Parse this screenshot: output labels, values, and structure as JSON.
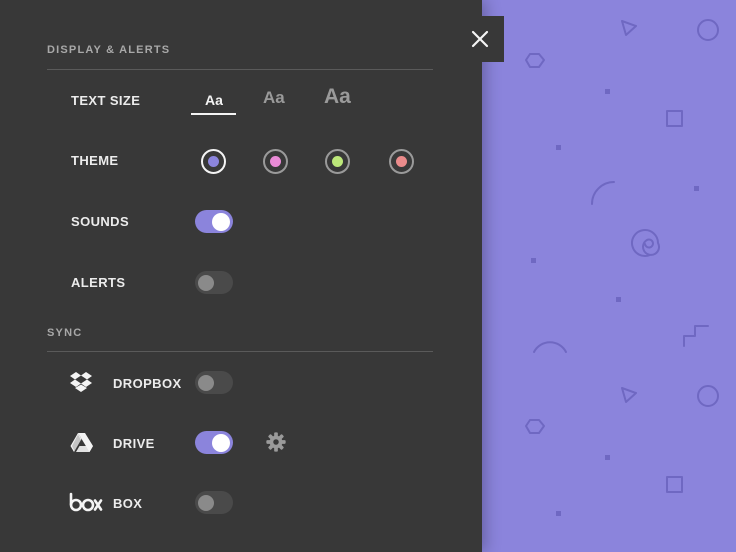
{
  "sections": {
    "display_title": "DISPLAY & ALERTS",
    "sync_title": "SYNC"
  },
  "settings": {
    "text_size": {
      "label": "TEXT SIZE",
      "options": [
        "Aa",
        "Aa",
        "Aa"
      ],
      "selected_index": 0
    },
    "theme": {
      "label": "THEME",
      "colors": [
        "#8b84dc",
        "#e98ad6",
        "#bde87a",
        "#ea8b8b"
      ],
      "selected_index": 0
    },
    "sounds": {
      "label": "SOUNDS",
      "enabled": true
    },
    "alerts": {
      "label": "ALERTS",
      "enabled": false
    }
  },
  "sync": {
    "dropbox": {
      "label": "DROPBOX",
      "enabled": false,
      "icon": "dropbox-icon"
    },
    "drive": {
      "label": "DRIVE",
      "enabled": true,
      "icon": "google-drive-icon",
      "settings_icon": "gear-icon"
    },
    "box": {
      "label": "BOX",
      "enabled": false,
      "icon": "box-icon"
    }
  },
  "colors": {
    "panel": "#383838",
    "accent": "#8b84dc",
    "background": "#8b84dc"
  }
}
